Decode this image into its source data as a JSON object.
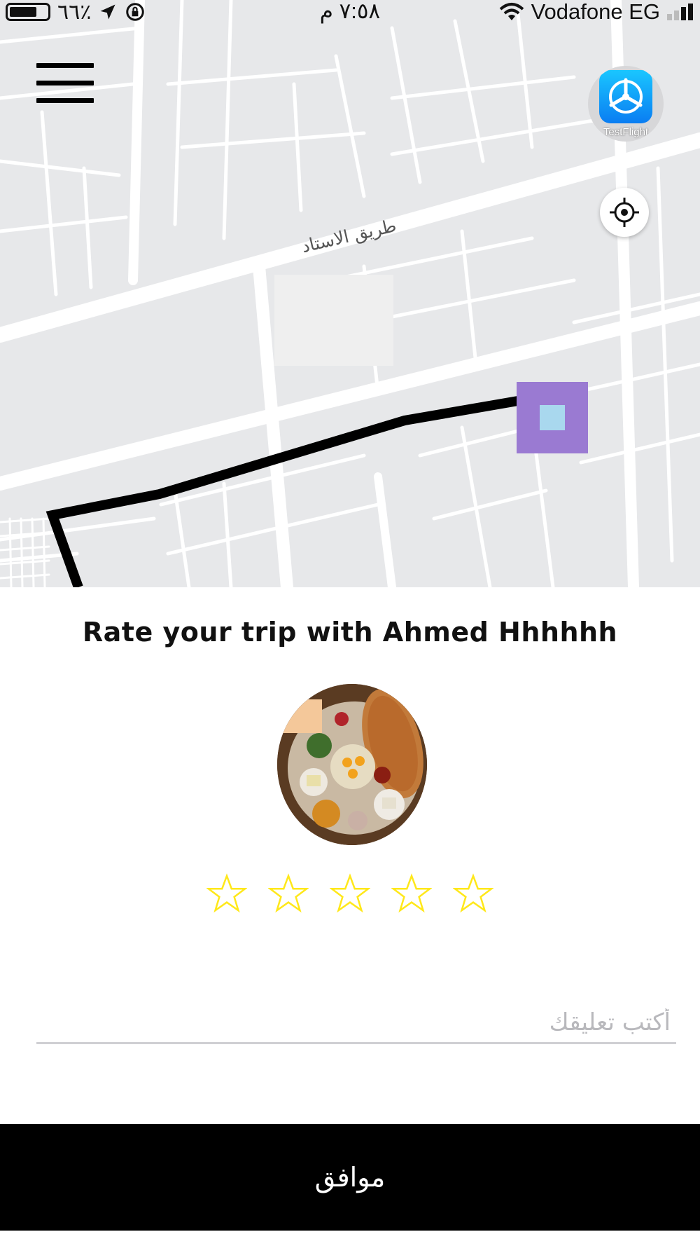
{
  "status_bar": {
    "battery_percent": "٦٦٪",
    "time": "٧:٥٨ م",
    "carrier": "Vodafone EG"
  },
  "map": {
    "road_label": "طريق الاستاد",
    "icons": {
      "menu": "hamburger-menu-icon",
      "locate": "crosshair-icon",
      "destination": "square-marker-icon",
      "testflight": "testflight-icon"
    },
    "colors": {
      "background": "#e7e8ea",
      "roads": "#ffffff",
      "route": "#000000",
      "marker_outer": "#9a7ad2",
      "marker_inner": "#a9d8ee"
    }
  },
  "testflight": {
    "label": "TestFlight"
  },
  "rating": {
    "title": "Rate your trip with Ahmed Hhhhhh",
    "star_count": 5,
    "star_color": "#ffe81a",
    "comment_placeholder": "أكتب تعليقك",
    "submit_label": "موافق"
  }
}
